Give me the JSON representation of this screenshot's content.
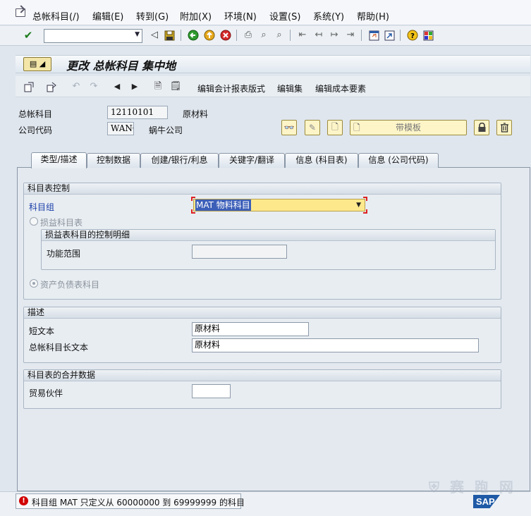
{
  "menu": {
    "items": [
      "总帐科目(/)",
      "编辑(E)",
      "转到(G)",
      "附加(X)",
      "环境(N)",
      "设置(S)",
      "系统(Y)",
      "帮助(H)"
    ]
  },
  "toolbar": {
    "command_field_value": "",
    "icons": [
      "check-icon",
      "back-icon",
      "save-icon",
      "back-arrow-icon",
      "exit-icon",
      "cancel-icon",
      "print-icon",
      "find-icon",
      "find-next-icon",
      "first-page-icon",
      "prev-page-icon",
      "next-page-icon",
      "last-page-icon",
      "new-session-icon",
      "shortcut-icon",
      "help-icon",
      "layout-icon"
    ]
  },
  "title": "更改 总帐科目 集中地",
  "app_toolbar": {
    "edit_fs_version": "编辑会计报表版式",
    "edit_set": "编辑集",
    "edit_cost_element": "编辑成本要素"
  },
  "header": {
    "gl_account_label": "总帐科目",
    "gl_account_value": "12110101",
    "gl_account_desc": "原材料",
    "company_code_label": "公司代码",
    "company_code_value": "WANG",
    "company_code_desc": "蜗牛公司",
    "template_button": "带模板"
  },
  "tabs": [
    {
      "label": "类型/描述",
      "active": true
    },
    {
      "label": "控制数据",
      "active": false
    },
    {
      "label": "创建/银行/利息",
      "active": false
    },
    {
      "label": "关键字/翻译",
      "active": false
    },
    {
      "label": "信息 (科目表)",
      "active": false
    },
    {
      "label": "信息 (公司代码)",
      "active": false
    }
  ],
  "coa_control": {
    "title": "科目表控制",
    "account_group_label": "科目组",
    "account_group_value": "MAT 物料科目",
    "pl_account_label": "损益科目表",
    "pl_detail_title": "损益表科目的控制明细",
    "functional_area_label": "功能范围",
    "functional_area_value": "",
    "balance_sheet_label": "资产负债表科目"
  },
  "description": {
    "title": "描述",
    "short_text_label": "短文本",
    "short_text_value": "原材料",
    "long_text_label": "总帐科目长文本",
    "long_text_value": "原材料"
  },
  "consolidation": {
    "title": "科目表的合并数据",
    "trading_partner_label": "贸易伙伴",
    "trading_partner_value": ""
  },
  "status": {
    "message": "科目组 MAT 只定义从 60000000 到 69999999 的科目",
    "type": "error"
  },
  "colors": {
    "error": "#d10000",
    "link_label": "#1a3ea8",
    "dropdown_bg": "#fde98c"
  }
}
